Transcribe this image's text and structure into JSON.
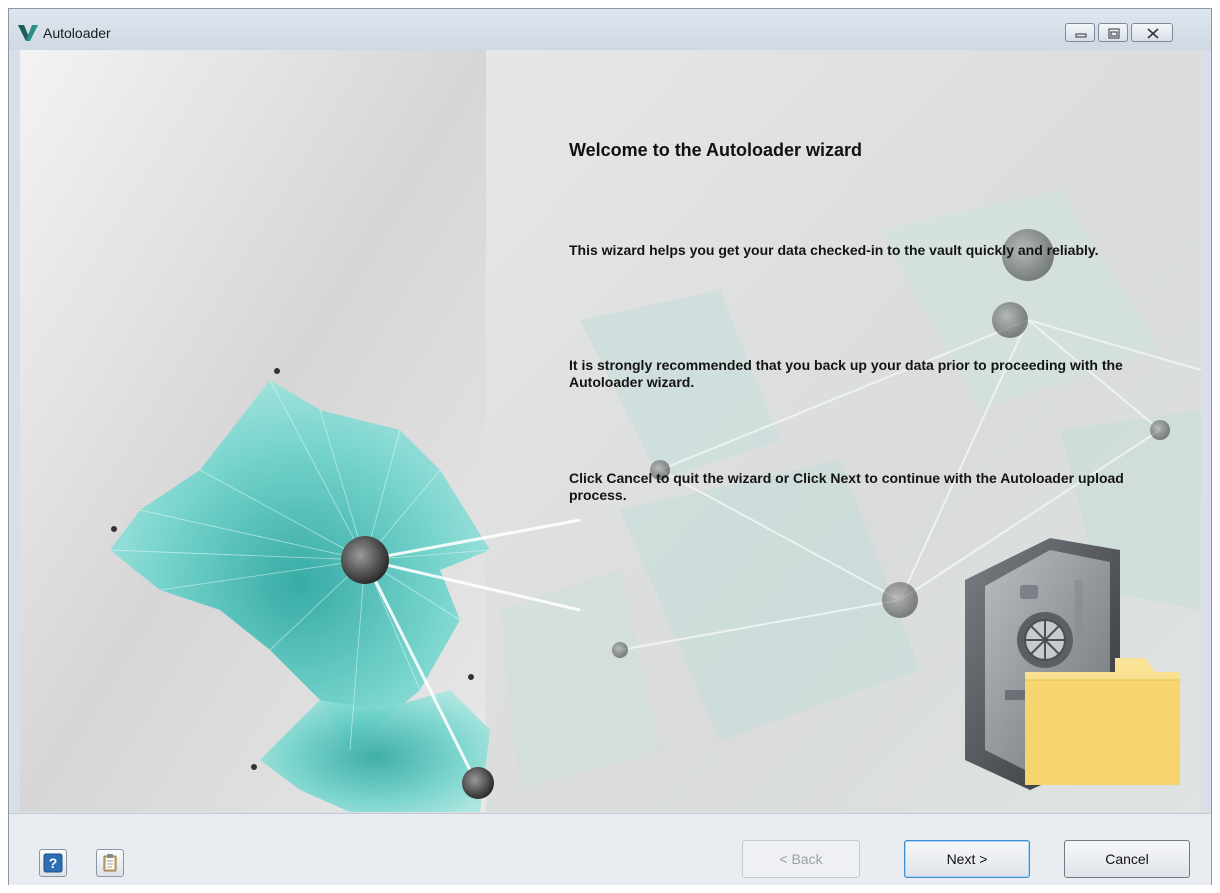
{
  "window": {
    "title": "Autoloader",
    "controls": {
      "minimize": "minimize-icon",
      "maximize": "maximize-icon",
      "close": "close-icon"
    }
  },
  "welcome": {
    "heading": "Welcome to the Autoloader wizard",
    "paragraphs": [
      "This wizard helps you get your data checked-in to the vault quickly and reliably.",
      "It is strongly recommended that you back up your data prior to proceeding with the Autoloader wizard.",
      "Click Cancel to quit the wizard or Click Next to continue with the Autoloader upload process."
    ]
  },
  "footer": {
    "help_icon": "help-icon",
    "notes_icon": "clipboard-icon",
    "back_label": "< Back",
    "back_enabled": false,
    "next_label": "Next >",
    "cancel_label": "Cancel"
  },
  "colors": {
    "accent_teal": "#4fc4bd",
    "folder_yellow": "#f4d46a",
    "default_button_border": "#3d8fd1"
  }
}
